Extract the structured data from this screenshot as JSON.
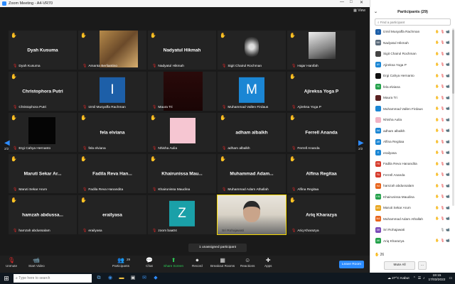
{
  "window": {
    "title": "Zoom Meeting - A4-VR70",
    "view_label": "View",
    "controls": [
      "—",
      "□",
      "✕"
    ]
  },
  "tiles": [
    {
      "center": "Dyah Kusuma",
      "label": "Dyah Kusuma",
      "hand": true,
      "type": "name"
    },
    {
      "center": "",
      "label": "Amanta Berliantino",
      "hand": true,
      "type": "photo-frame"
    },
    {
      "center": "Nadyatul Hikmah",
      "label": "Nadyatul Hikmah",
      "hand": true,
      "type": "name"
    },
    {
      "center": "",
      "label": "Sigit Chairul Rochman",
      "hand": true,
      "type": "emblem"
    },
    {
      "center": "",
      "label": "Hajar Hanifah",
      "hand": true,
      "type": "photo-bw"
    },
    {
      "center": "Christophora Putri",
      "label": "Christophora Putri",
      "hand": true,
      "type": "name"
    },
    {
      "center": "I",
      "label": "Izmil Musyaffa Rachman",
      "hand": false,
      "type": "letter",
      "color": "#1d5fa8"
    },
    {
      "center": "",
      "label": "Maura Tri",
      "hand": false,
      "type": "dark-photo"
    },
    {
      "center": "M",
      "label": "Muhammad Vallen Firdaus",
      "hand": false,
      "type": "letter",
      "color": "#1b86d4"
    },
    {
      "center": "Ajireksa Yoga P",
      "label": "Ajireksa Yoga P",
      "hand": true,
      "type": "name"
    },
    {
      "center": "",
      "label": "Ergi Cahya Hernanto",
      "hand": true,
      "type": "black"
    },
    {
      "center": "fela elviana",
      "label": "fela elviana",
      "hand": true,
      "type": "name"
    },
    {
      "center": "",
      "label": "Nhisha Aulia",
      "hand": true,
      "type": "pink"
    },
    {
      "center": "adham albalkh",
      "label": "adham albalkh",
      "hand": true,
      "type": "name"
    },
    {
      "center": "Ferrell Ananda",
      "label": "Ferrell Ananda",
      "hand": true,
      "type": "name"
    },
    {
      "center": "Maruti Sekar Ar...",
      "label": "Maruti Sekar Arum",
      "hand": true,
      "type": "name"
    },
    {
      "center": "Fadila Reva Han...",
      "label": "Fadila Reva Hanandita",
      "hand": true,
      "type": "name"
    },
    {
      "center": "Khairunissa Mau...",
      "label": "Khairunissa Maudina",
      "hand": true,
      "type": "name"
    },
    {
      "center": "Muhammad Adam...",
      "label": "Muhammad Adam Athallah",
      "hand": true,
      "type": "name"
    },
    {
      "center": "Alfina Regitaa",
      "label": "Alfina Regitaa",
      "hand": true,
      "type": "name"
    },
    {
      "center": "hamzah abdussa...",
      "label": "hamzah abdussalam",
      "hand": true,
      "type": "name"
    },
    {
      "center": "erailyasa",
      "label": "erailyasa",
      "hand": true,
      "type": "name"
    },
    {
      "center": "Z",
      "label": "zoom baa04",
      "hand": false,
      "type": "letter",
      "color": "#1aa0a8"
    },
    {
      "center": "",
      "label": "Sri Rohajawati",
      "hand": false,
      "type": "video",
      "active": true
    },
    {
      "center": "Ariq Kharazya",
      "label": "Ariq Kharazya",
      "hand": true,
      "type": "name"
    }
  ],
  "pager": {
    "left_arrow": "◀",
    "right_arrow": "▶",
    "left_page": "2/2",
    "right_page": "2/2"
  },
  "toast": "1 unassigned participant",
  "toolbar": {
    "unmute": "Unmute",
    "start_video": "Start Video",
    "participants": "Participants",
    "participants_count": "29",
    "chat": "Chat",
    "share_screen": "Share Screen",
    "record": "Record",
    "breakout_rooms": "Breakout Rooms",
    "reactions": "Reactions",
    "apps": "Apps",
    "leave_room": "Leave Room"
  },
  "panel": {
    "title": "Participants (29)",
    "search_placeholder": "Find a participant",
    "participants": [
      {
        "initials": "I",
        "name": "Izmil Musyaffa Rachman",
        "color": "#1d5fa8",
        "hand": true,
        "video_off": true
      },
      {
        "initials": "NH",
        "name": "Nadyatul Hikmah",
        "color": "#5a6a7a",
        "hand": true,
        "video_off": true
      },
      {
        "initials": "",
        "name": "Sigit Chairul Rochman",
        "color": "#444444",
        "hand": true,
        "video_off": true
      },
      {
        "initials": "AY",
        "name": "Ajireksa Yoga P",
        "color": "#1b86d4",
        "hand": true,
        "video_off": true
      },
      {
        "initials": "",
        "name": "Ergi Cahya Hernanto",
        "color": "#111111",
        "hand": true,
        "video_off": true
      },
      {
        "initials": "FE",
        "name": "fela elviana",
        "color": "#23a14a",
        "hand": true,
        "video_off": true
      },
      {
        "initials": "",
        "name": "Maura Tri",
        "color": "#5a2222",
        "hand": true,
        "video_off": true
      },
      {
        "initials": "",
        "name": "Muhammad Vallen Firdaus",
        "color": "#1b86d4",
        "hand": true,
        "video_off": true
      },
      {
        "initials": "",
        "name": "Nhisha Aulia",
        "color": "#f1b3c4",
        "hand": true,
        "video_off": true
      },
      {
        "initials": "AA",
        "name": "adham albalkh",
        "color": "#1b86d4",
        "hand": true,
        "video_off": true
      },
      {
        "initials": "AR",
        "name": "Alfina Regitaa",
        "color": "#1b86d4",
        "hand": true,
        "video_off": true
      },
      {
        "initials": "E",
        "name": "erailyasa",
        "color": "#1b86d4",
        "hand": true,
        "video_off": true
      },
      {
        "initials": "FR",
        "name": "Fadila Reva Hanandita",
        "color": "#d63a2b",
        "hand": true,
        "video_off": true
      },
      {
        "initials": "FA",
        "name": "Ferrell Ananda",
        "color": "#d63a2b",
        "hand": true,
        "video_off": true
      },
      {
        "initials": "HA",
        "name": "hamzah abdussalam",
        "color": "#e8641b",
        "hand": true,
        "video_off": true
      },
      {
        "initials": "KM",
        "name": "Khairunissa Maudina",
        "color": "#23a14a",
        "hand": true,
        "video_off": true
      },
      {
        "initials": "MS",
        "name": "Maruti Sekar Arum",
        "color": "#e8a41b",
        "hand": true,
        "video_off": true
      },
      {
        "initials": "MA",
        "name": "Muhammad Adam Athallah",
        "color": "#e8641b",
        "hand": true,
        "video_off": true
      },
      {
        "initials": "SR",
        "name": "Sri Rohajawati",
        "color": "#7b4ab8",
        "hand": false,
        "video_off": false
      },
      {
        "initials": "AK",
        "name": "Ariq Kharazya",
        "color": "#23a14a",
        "hand": true,
        "video_off": true
      }
    ],
    "hands_raised": "26",
    "mute_all": "Mute All",
    "more": "..."
  },
  "taskbar": {
    "search_placeholder": "Type here to search",
    "weather": "27°C Kabut",
    "time": "19:15",
    "date": "17/03/2022"
  }
}
